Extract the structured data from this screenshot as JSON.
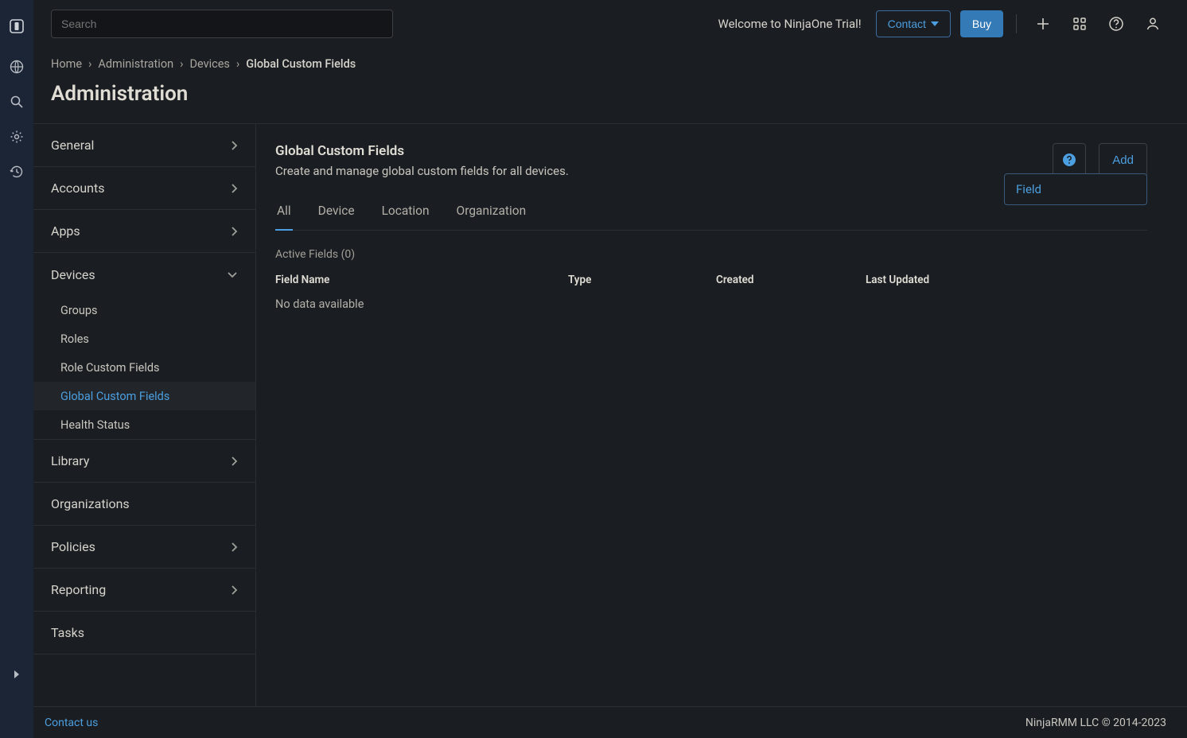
{
  "search": {
    "placeholder": "Search"
  },
  "header": {
    "welcome": "Welcome to NinjaOne Trial!",
    "contact": "Contact",
    "buy": "Buy"
  },
  "breadcrumbs": {
    "home": "Home",
    "administration": "Administration",
    "devices": "Devices",
    "current": "Global Custom Fields"
  },
  "page_title": "Administration",
  "sidebar": {
    "items": [
      {
        "label": "General",
        "chevron": "right"
      },
      {
        "label": "Accounts",
        "chevron": "right"
      },
      {
        "label": "Apps",
        "chevron": "right"
      },
      {
        "label": "Devices",
        "chevron": "down",
        "subs": [
          {
            "label": "Groups"
          },
          {
            "label": "Roles"
          },
          {
            "label": "Role Custom Fields"
          },
          {
            "label": "Global Custom Fields",
            "active": true
          },
          {
            "label": "Health Status"
          }
        ]
      },
      {
        "label": "Library",
        "chevron": "right"
      },
      {
        "label": "Organizations",
        "chevron": "none"
      },
      {
        "label": "Policies",
        "chevron": "right"
      },
      {
        "label": "Reporting",
        "chevron": "right"
      },
      {
        "label": "Tasks",
        "chevron": "none"
      }
    ]
  },
  "content": {
    "title": "Global Custom Fields",
    "subtitle": "Create and manage global custom fields for all devices.",
    "add": "Add",
    "tooltip": "Field",
    "tabs": [
      "All",
      "Device",
      "Location",
      "Organization"
    ],
    "active_tab": 0,
    "active_fields_label": "Active Fields (0)",
    "columns": [
      "Field Name",
      "Type",
      "Created",
      "Last Updated"
    ],
    "no_data": "No data available"
  },
  "footer": {
    "contact": "Contact us",
    "copyright": "NinjaRMM LLC © 2014-2023"
  }
}
